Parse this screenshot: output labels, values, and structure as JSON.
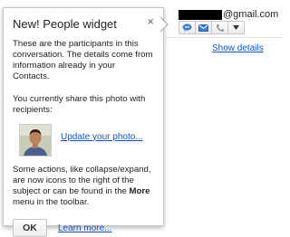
{
  "widget": {
    "email_suffix": "@gmail.com",
    "show_details": "Show details",
    "actions": [
      {
        "name": "chat-icon",
        "color": "#3d7de0"
      },
      {
        "name": "mail-icon",
        "color": "#3d7de0"
      },
      {
        "name": "phone-icon",
        "color": "#999999"
      },
      {
        "name": "dropdown-arrow-icon",
        "color": "#333333"
      }
    ]
  },
  "bubble": {
    "title": "New! People widget",
    "close": "×",
    "para1": "These are the participants in this conversation. The details come from information already in your Contacts.",
    "para2": "You currently share this photo with recipients:",
    "update_link": "Update your photo...",
    "para3_before": "Some actions, like collapse/expand, are now icons to the right of the subject or can be found in the ",
    "para3_bold": "More",
    "para3_after": " menu in the toolbar.",
    "ok_label": "OK",
    "learn_more": "Learn more..."
  }
}
